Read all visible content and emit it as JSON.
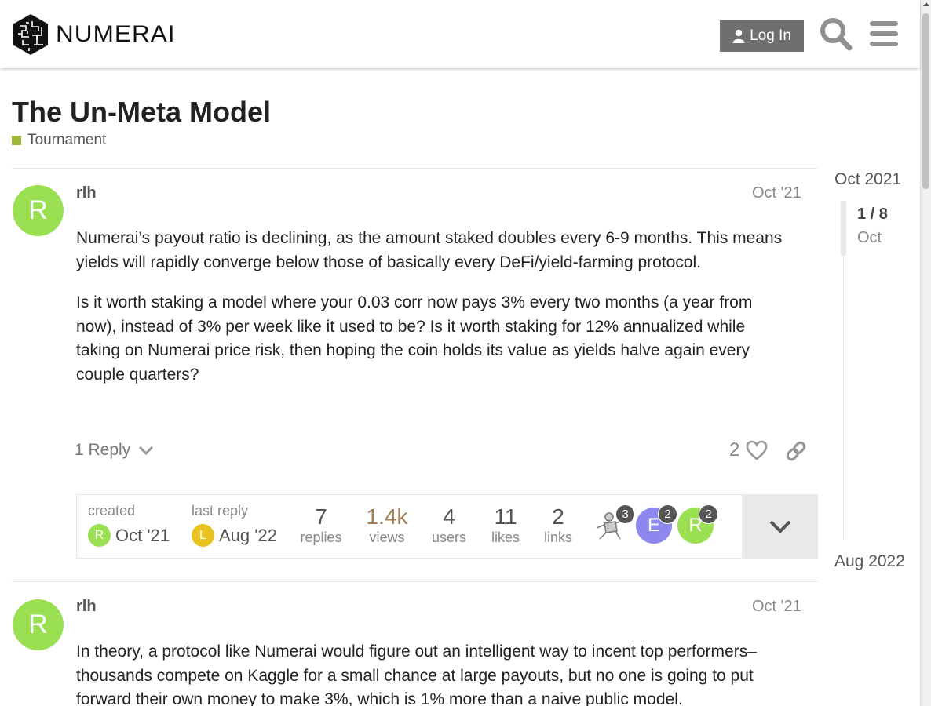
{
  "header": {
    "logo_text": "NUMERAI",
    "login_label": "Log In"
  },
  "topic": {
    "title": "The Un-Meta Model",
    "category": "Tournament"
  },
  "posts": [
    {
      "avatar_letter": "R",
      "username": "rlh",
      "date": "Oct '21",
      "paragraphs": [
        "Numerai’s payout ratio is declining, as the amount staked doubles every 6-9 months. This means yields will rapidly converge below those of basically every DeFi/yield-farming protocol.",
        "Is it worth staking a model where your 0.03 corr now pays 3% every two months (a year from now), instead of 3% per week like it used to be? Is it worth staking for 12% annualized while taking on Numerai price risk, then hoping the coin holds its value as yields halve again every couple quarters?"
      ],
      "reply_label": "1 Reply",
      "like_count": "2"
    },
    {
      "avatar_letter": "R",
      "username": "rlh",
      "date": "Oct '21",
      "paragraphs": [
        "In theory, a protocol like Numerai would figure out an intelligent way to incent top performers–thousands compete on Kaggle for a small chance at large payouts, but no one is going to put forward their own money to make 3%, which is 1% more than a naive public model."
      ]
    }
  ],
  "topic_map": {
    "created_label": "created",
    "created_avatar": "R",
    "created_date": "Oct '21",
    "last_reply_label": "last reply",
    "last_reply_avatar": "L",
    "last_reply_date": "Aug '22",
    "stats": [
      {
        "num": "7",
        "label": "replies"
      },
      {
        "num": "1.4k",
        "label": "views"
      },
      {
        "num": "4",
        "label": "users"
      },
      {
        "num": "11",
        "label": "likes"
      },
      {
        "num": "2",
        "label": "links"
      }
    ],
    "participants": [
      {
        "letter": "",
        "count": "3"
      },
      {
        "letter": "E",
        "count": "2"
      },
      {
        "letter": "R",
        "count": "2"
      }
    ]
  },
  "timeline": {
    "start": "Oct 2021",
    "position": "1 / 8",
    "current_date": "Oct",
    "end": "Aug 2022"
  },
  "colors": {
    "avatar_r": "#9ae052",
    "avatar_l": "#e8c220",
    "avatar_e": "#8e88ee",
    "category": "#9eb83b"
  }
}
